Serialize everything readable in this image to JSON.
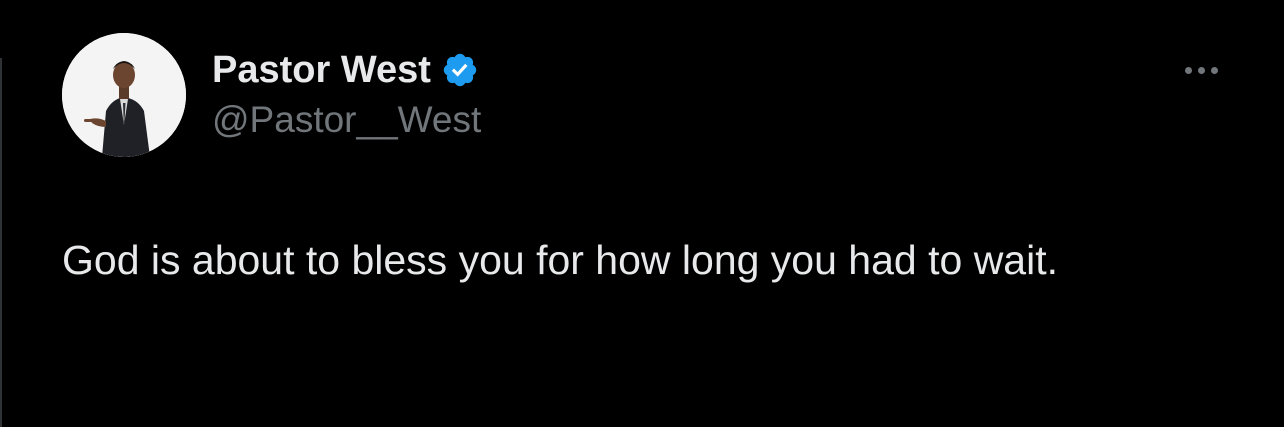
{
  "tweet": {
    "author": {
      "display_name": "Pastor West",
      "handle": "@Pastor__West",
      "verified": true,
      "verified_icon": "verified-badge-icon",
      "avatar": "profile-photo"
    },
    "text": "God is about to bless you for how long you had to wait.",
    "more_icon": "more-options-icon"
  },
  "colors": {
    "background": "#000000",
    "primary_text": "#e7e9ea",
    "secondary_text": "#71767b",
    "verified_blue": "#1d9bf0"
  }
}
